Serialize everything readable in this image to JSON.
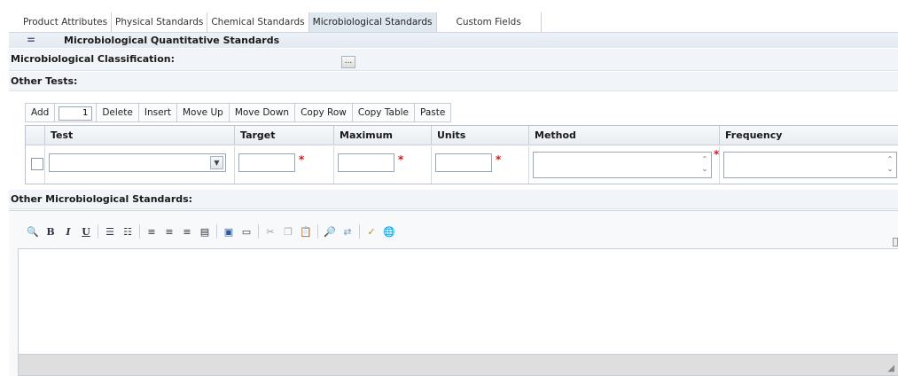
{
  "tabs": [
    {
      "label": "Product Attributes"
    },
    {
      "label": "Physical Standards"
    },
    {
      "label": "Chemical Standards"
    },
    {
      "label": "Microbiological Standards"
    },
    {
      "label": "Custom Fields"
    }
  ],
  "section": {
    "collapse_icon": "=",
    "title": "Microbiological Quantitative Standards"
  },
  "classification": {
    "label": "Microbiological Classification:",
    "lookup_button": "..."
  },
  "other_tests": {
    "label": "Other Tests:",
    "toolbar": {
      "add": "Add",
      "count": "1",
      "delete": "Delete",
      "insert": "Insert",
      "move_up": "Move Up",
      "move_down": "Move Down",
      "copy_row": "Copy Row",
      "copy_table": "Copy Table",
      "paste": "Paste"
    },
    "columns": [
      "Test",
      "Target",
      "Maximum",
      "Units",
      "Method",
      "Frequency"
    ],
    "row": {
      "test": "",
      "target": "",
      "maximum": "",
      "units": "",
      "method": "",
      "frequency": ""
    }
  },
  "other_standards": {
    "label": "Other Microbiological Standards:",
    "editor_icons": [
      "preview-icon",
      "bold-icon",
      "italic-icon",
      "underline-icon",
      "ordered-list-icon",
      "unordered-list-icon",
      "align-left-icon",
      "align-center-icon",
      "align-right-icon",
      "justify-icon",
      "table-icon",
      "horizontal-rule-icon",
      "cut-icon",
      "copy-icon",
      "paste-icon",
      "find-icon",
      "replace-icon",
      "spellcheck-icon",
      "link-icon"
    ]
  },
  "colors": {
    "accent": "#dfe7ef",
    "required": "#d01818",
    "section_bg": "#edf2f7"
  }
}
